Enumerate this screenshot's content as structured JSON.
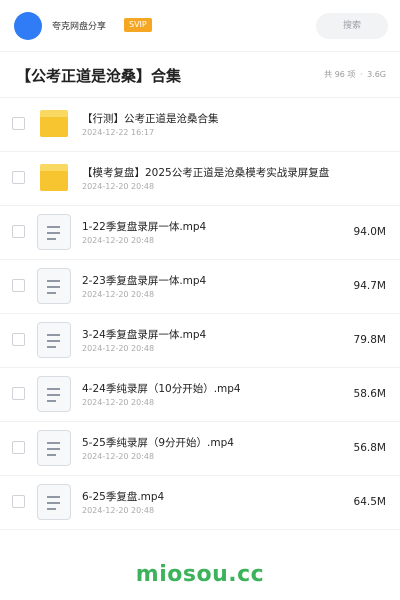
{
  "header": {
    "uploader": "夸克网盘分享",
    "badge": "SVIP",
    "search_label": "搜索"
  },
  "folder": {
    "title": "【公考正道是沧桑】合集",
    "count_text": "共 96 项",
    "separator": "·",
    "total_size": "3.6G"
  },
  "items": [
    {
      "type": "folder",
      "name": "【行测】公考正道是沧桑合集",
      "date": "2024-12-22 16:17",
      "size": ""
    },
    {
      "type": "folder",
      "name": "【模考复盘】2025公考正道是沧桑模考实战录屏复盘",
      "date": "2024-12-20 20:48",
      "size": ""
    },
    {
      "type": "file",
      "name": "1-22季复盘录屏一体.mp4",
      "date": "2024-12-20 20:48",
      "size": "94.0M"
    },
    {
      "type": "file",
      "name": "2-23季复盘录屏一体.mp4",
      "date": "2024-12-20 20:48",
      "size": "94.7M"
    },
    {
      "type": "file",
      "name": "3-24季复盘录屏一体.mp4",
      "date": "2024-12-20 20:48",
      "size": "79.8M"
    },
    {
      "type": "file",
      "name": "4-24季纯录屏（10分开始）.mp4",
      "date": "2024-12-20 20:48",
      "size": "58.6M"
    },
    {
      "type": "file",
      "name": "5-25季纯录屏（9分开始）.mp4",
      "date": "2024-12-20 20:48",
      "size": "56.8M"
    },
    {
      "type": "file",
      "name": "6-25季复盘.mp4",
      "date": "2024-12-20 20:48",
      "size": "64.5M"
    }
  ],
  "watermark": "miosou.cc",
  "colors": {
    "avatar": "#2f7cf6",
    "badge": "#f5a623",
    "folder": "#f7c52f",
    "watermark": "#3cb25b"
  }
}
